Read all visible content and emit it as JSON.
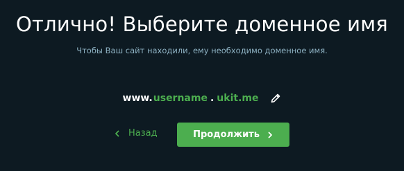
{
  "header": {
    "title": "Отлично! Выберите доменное имя",
    "subtitle": "Чтобы Ваш сайт находили, ему необходимо доменное имя."
  },
  "domain": {
    "prefix": "www.",
    "name": "username",
    "separator": ".",
    "suffix": "ukit.me",
    "edit_icon": "pencil-icon"
  },
  "actions": {
    "back_label": "Назад",
    "back_icon": "chevron-left-icon",
    "continue_label": "Продолжить",
    "continue_icon": "chevron-right-icon"
  },
  "colors": {
    "background": "#0d1a22",
    "accent": "#4cae4f",
    "subtitle": "#8fb3c4",
    "text": "#ffffff"
  }
}
